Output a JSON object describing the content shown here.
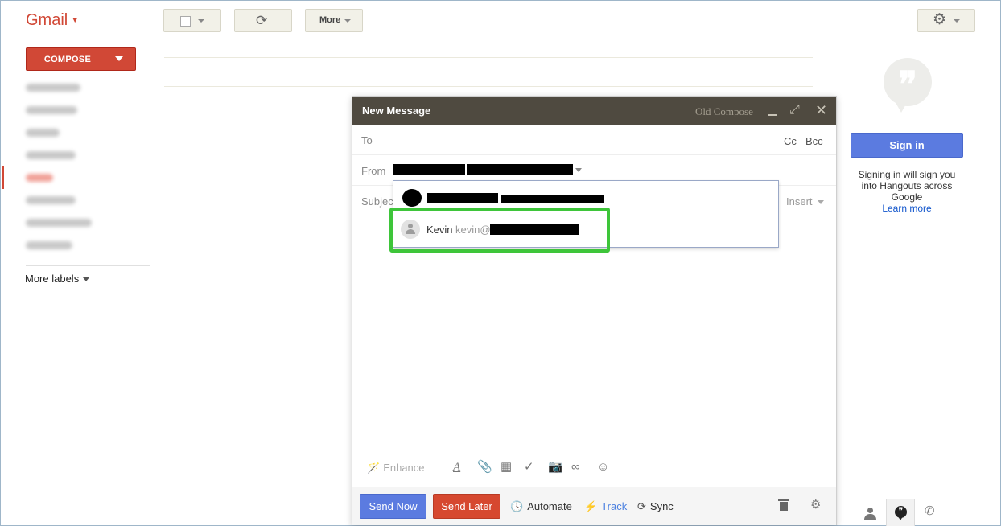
{
  "app": {
    "logo": "Gmail"
  },
  "compose_button": {
    "label": "COMPOSE"
  },
  "nav": {
    "more_labels": "More labels"
  },
  "toolbar": {
    "more_label": "More",
    "refresh_glyph": "⟳",
    "gear_glyph": "⚙"
  },
  "compose_window": {
    "title": "New Message",
    "old_compose": "Old Compose",
    "to_label": "To",
    "cc_label": "Cc",
    "bcc_label": "Bcc",
    "from_label": "From",
    "subject_label": "Subject",
    "insert_label": "Insert"
  },
  "from_dropdown": {
    "options": [
      {
        "name": "Kevin",
        "email_prefix": "kevin@"
      }
    ]
  },
  "editor_toolbar": {
    "enhance_label": "Enhance",
    "icons": [
      "magic-wand-icon",
      "font-icon",
      "paperclip-icon",
      "calendar-icon",
      "check-circle-icon",
      "camera-icon",
      "link-icon",
      "smiley-icon"
    ]
  },
  "bottom_bar": {
    "send_now": "Send Now",
    "send_later": "Send Later",
    "automate": "Automate",
    "track": "Track",
    "sync": "Sync"
  },
  "hangouts": {
    "sign_in": "Sign in",
    "description": "Signing in will sign you into Hangouts across Google",
    "learn_more": "Learn more"
  },
  "colors": {
    "gmail_red": "#d14836",
    "compose_header": "#4f4a40",
    "send_now_blue": "#5b7be0",
    "send_later_red": "#d6482f",
    "highlight_green": "#3ec53a",
    "link_blue": "#1155cc"
  }
}
